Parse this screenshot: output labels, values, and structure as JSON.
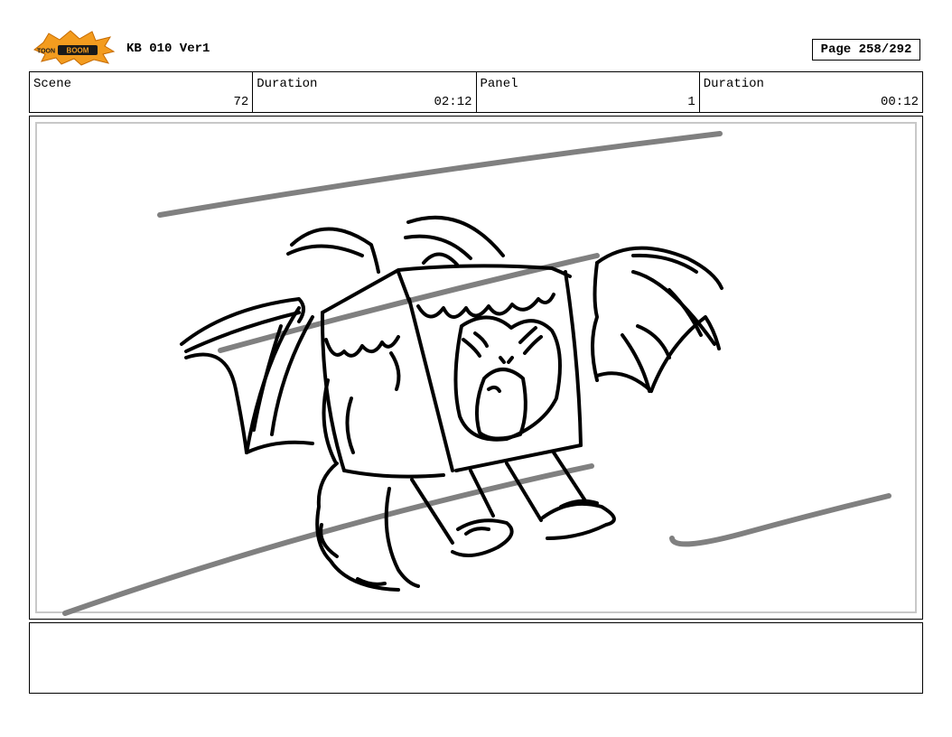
{
  "header": {
    "logo": {
      "icon": "toonboom-logo",
      "text_left": "TOON",
      "text_right": "BOOM"
    },
    "title": "KB 010 Ver1",
    "page": "Page 258/292"
  },
  "info": [
    {
      "label": "Scene",
      "value": "72"
    },
    {
      "label": "Duration",
      "value": "02:12"
    },
    {
      "label": "Panel",
      "value": "1"
    },
    {
      "label": "Duration",
      "value": "00:12"
    }
  ],
  "panel": {
    "image_icon": "flying-winged-creature-sketch"
  },
  "notes": {
    "text": ""
  },
  "colors": {
    "logo_orange": "#f39c1f",
    "logo_dark": "#1a1a1a",
    "speed_lines": "#808080",
    "frame_inner": "#c8c8c8"
  }
}
